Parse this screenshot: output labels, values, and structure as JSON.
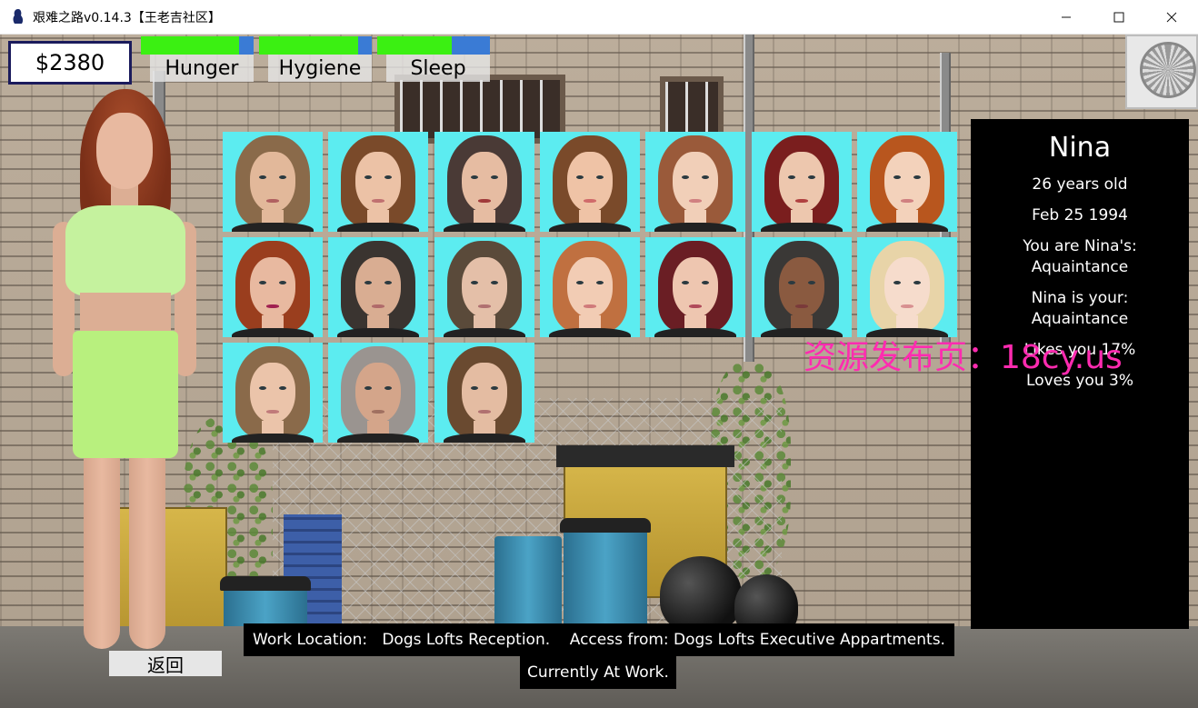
{
  "window": {
    "title": "艰难之路v0.14.3【王老吉社区】",
    "minimize_icon": "minimize-icon",
    "maximize_icon": "maximize-icon",
    "close_icon": "close-icon"
  },
  "hud": {
    "money": "$2380",
    "stats": [
      {
        "label": "Hunger",
        "fill": 0.87
      },
      {
        "label": "Hygiene",
        "fill": 0.88
      },
      {
        "label": "Sleep",
        "fill": 0.66
      }
    ]
  },
  "portraits": [
    {
      "id": "p1",
      "hair": "#8a6a4a",
      "skin": "#e2b89a",
      "lip": "#b06060"
    },
    {
      "id": "p2",
      "hair": "#7a4a2a",
      "skin": "#ecc2a6",
      "lip": "#c07070"
    },
    {
      "id": "p3",
      "hair": "#4a3a36",
      "skin": "#e6bca2",
      "lip": "#a03a3a"
    },
    {
      "id": "p4",
      "hair": "#7a4a2a",
      "skin": "#efc3a6",
      "lip": "#d06a6a"
    },
    {
      "id": "p5",
      "hair": "#9a5a3a",
      "skin": "#f1cfb8",
      "lip": "#d08080"
    },
    {
      "id": "p6",
      "hair": "#7a1e1e",
      "skin": "#edc7ae",
      "lip": "#b04040"
    },
    {
      "id": "p7",
      "hair": "#b8561e",
      "skin": "#f3d2bb",
      "lip": "#d08080"
    },
    {
      "id": "p8",
      "hair": "#9a3e1e",
      "skin": "#e8b9a0",
      "lip": "#a02050"
    },
    {
      "id": "p9",
      "hair": "#3a3430",
      "skin": "#d9ad92",
      "lip": "#b06a6a"
    },
    {
      "id": "p10",
      "hair": "#5a4a3a",
      "skin": "#e4bfa8",
      "lip": "#b07070"
    },
    {
      "id": "p11",
      "hair": "#c07040",
      "skin": "#f2ccb4",
      "lip": "#d07a7a"
    },
    {
      "id": "p12",
      "hair": "#6a1e24",
      "skin": "#eec6b0",
      "lip": "#b04a5a"
    },
    {
      "id": "p13",
      "hair": "#3a3836",
      "skin": "#8a5a40",
      "lip": "#7a3a3a"
    },
    {
      "id": "p14",
      "hair": "#e8d4a8",
      "skin": "#f6dccc",
      "lip": "#d89090"
    },
    {
      "id": "p15",
      "hair": "#8a6a4a",
      "skin": "#ebc4aa",
      "lip": "#c07a7a"
    },
    {
      "id": "p16",
      "hair": "#9a9490",
      "skin": "#d4a58a",
      "lip": "#a07060"
    },
    {
      "id": "p17",
      "hair": "#6a4a30",
      "skin": "#e4bca2",
      "lip": "#b07070"
    }
  ],
  "info": {
    "name": "Nina",
    "age": "26 years old",
    "dob": "Feb 25 1994",
    "you_are_label": "You are Nina's:",
    "you_are_value": "Aquaintance",
    "is_your_label": "Nina is your:",
    "is_your_value": "Aquaintance",
    "likes": "Likes you 17%",
    "loves": "Loves you 3%"
  },
  "watermark": "资源发布页：18cy.us",
  "footer": {
    "work_location": "Work Location:   Dogs Lofts Reception.    Access from: Dogs Lofts Executive Appartments.",
    "status": "Currently At Work.",
    "back_label": "返回"
  }
}
